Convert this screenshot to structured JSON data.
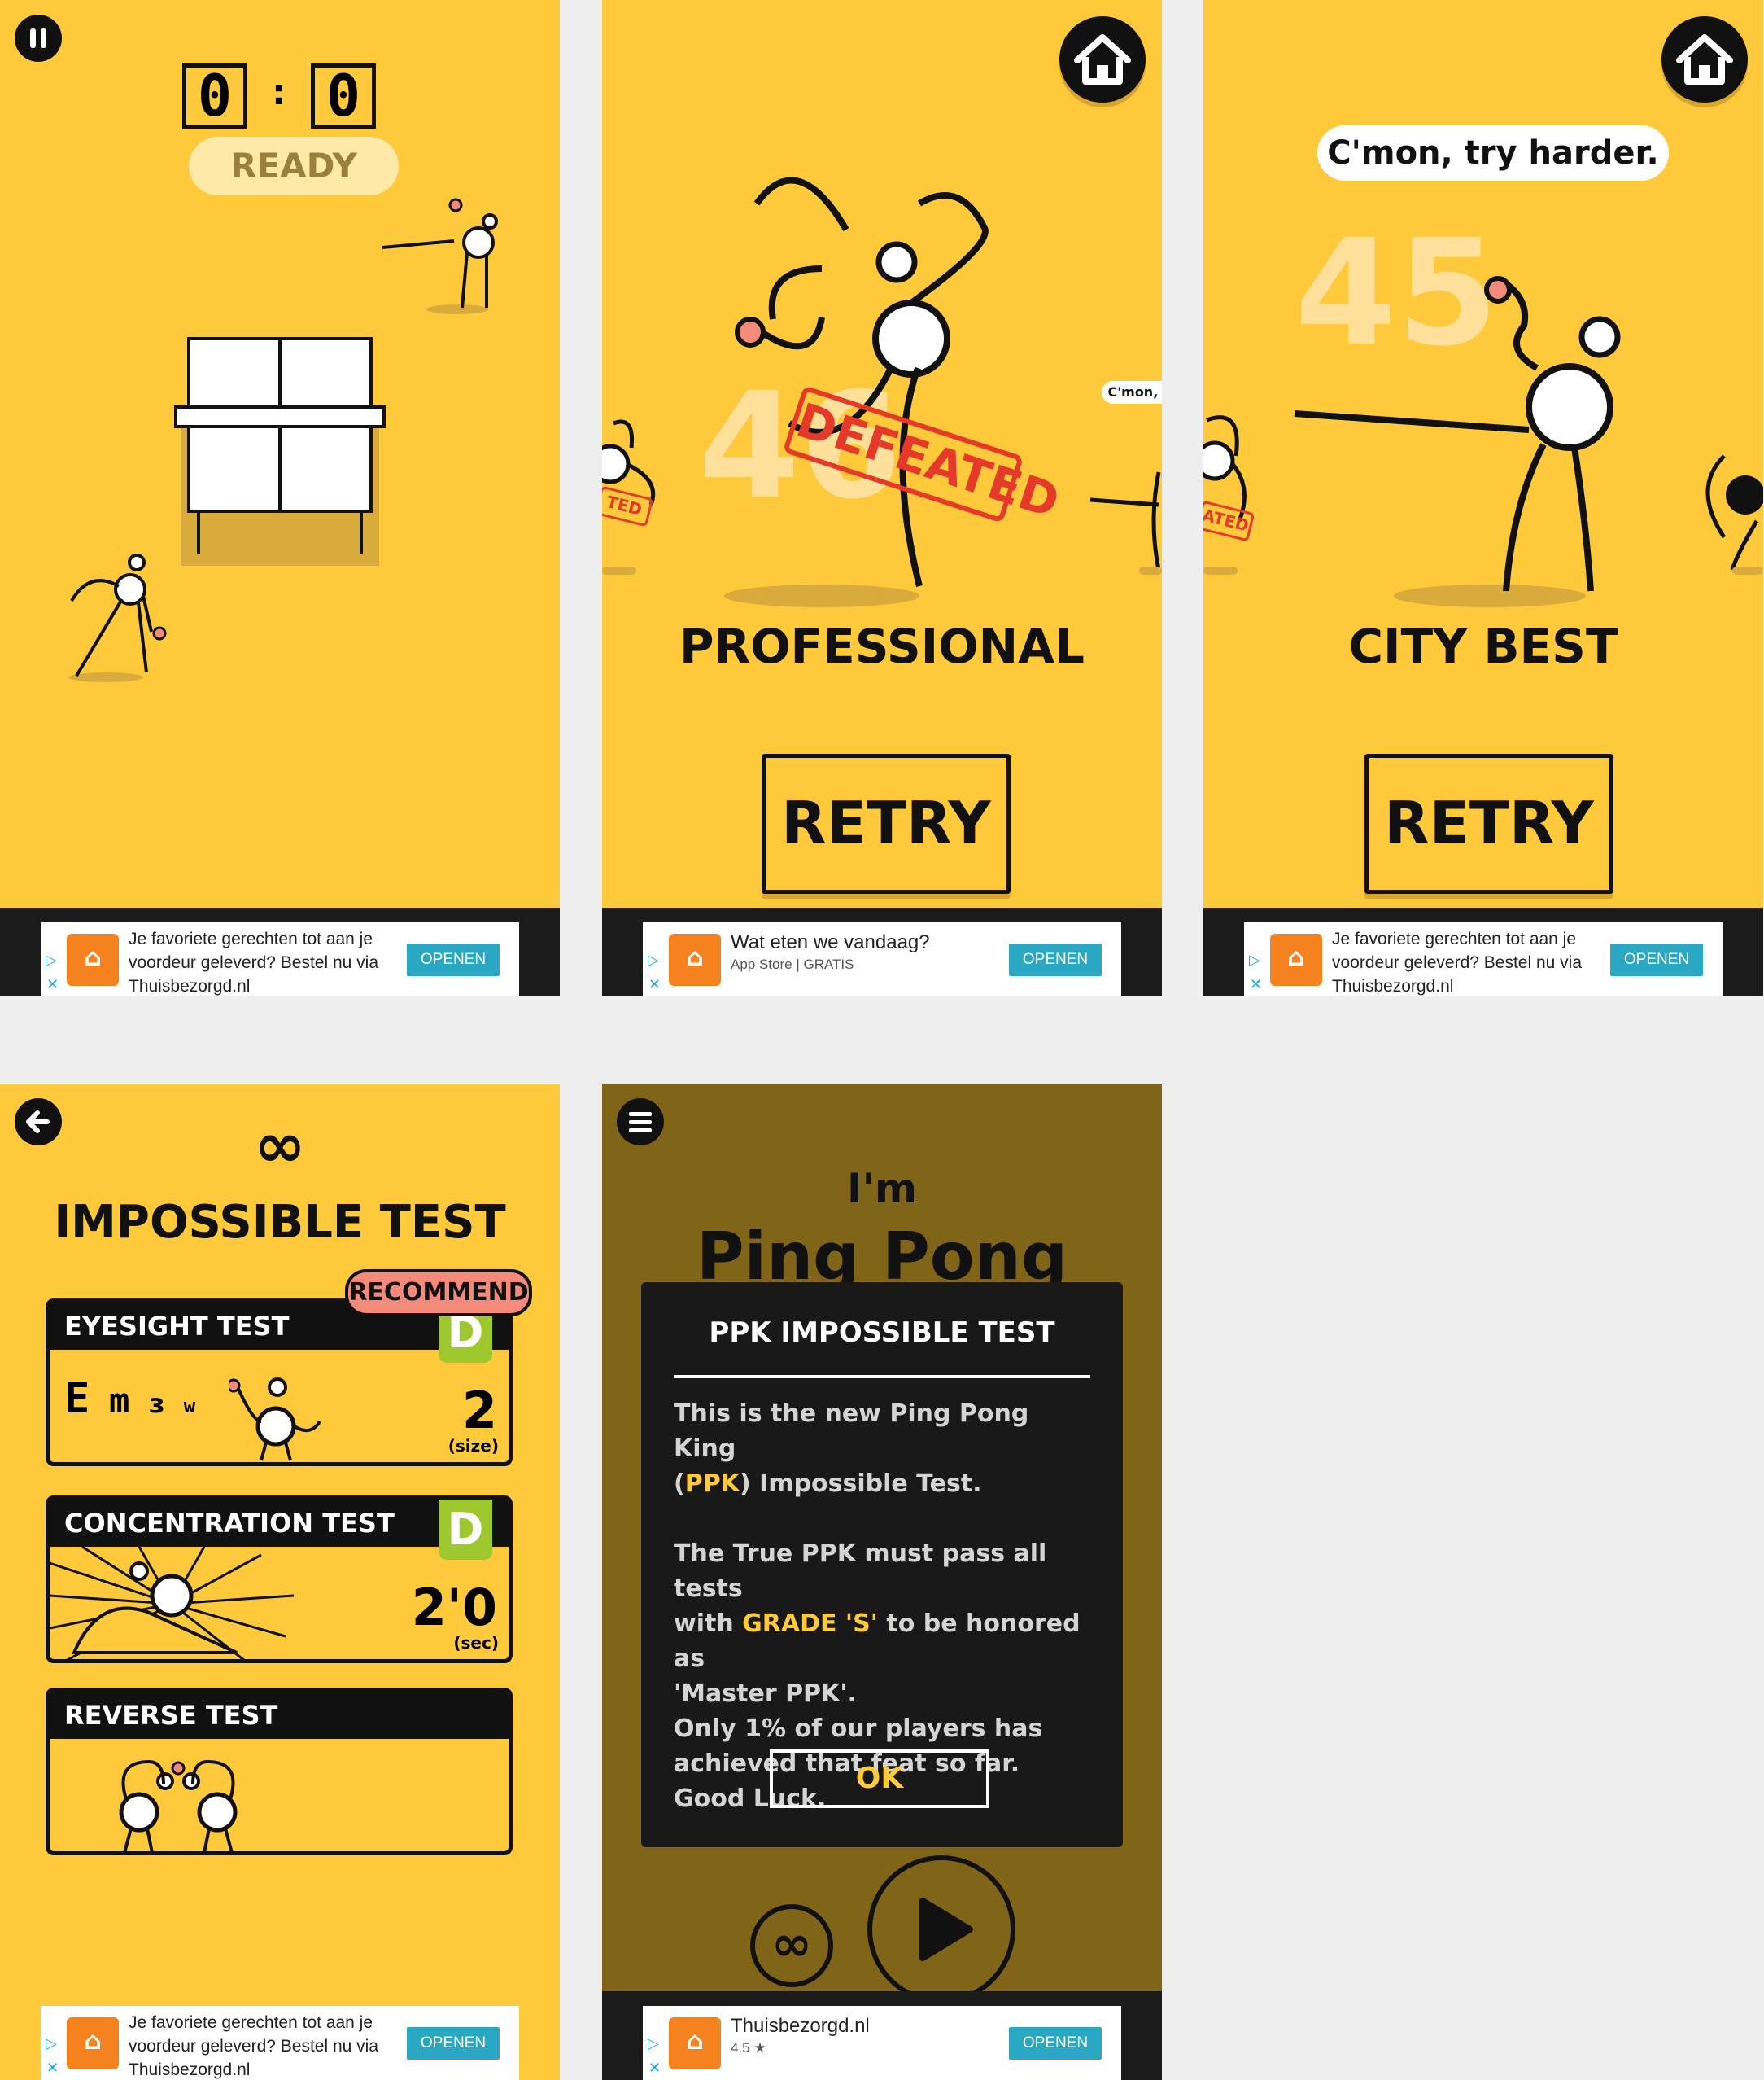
{
  "colors": {
    "yellow": "#fec93a",
    "dark": "#111111",
    "grade_green": "#9ec92e",
    "ad_button": "#2aa7c3",
    "recommend": "#f48a7a"
  },
  "screen1": {
    "pause_icon": "pause-icon",
    "score_left": "0",
    "score_sep": ":",
    "score_right": "0",
    "ready_label": "READY"
  },
  "screen2": {
    "home_icon": "home-icon",
    "big_score": "46",
    "stamp": "DEFEATED",
    "small_stamp": "TED",
    "peek_bubble": "C'mon, t",
    "rank": "PROFESSIONAL",
    "retry_label": "RETRY"
  },
  "screen3": {
    "home_icon": "home-icon",
    "bubble": "C'mon, try harder.",
    "big_score": "45",
    "small_stamp": "ATED",
    "rank": "CITY BEST",
    "retry_label": "RETRY"
  },
  "screen4": {
    "back_icon": "back-arrow-icon",
    "infinity": "∞",
    "title": "IMPOSSIBLE TEST",
    "recommend": "RECOMMEND",
    "tests": [
      {
        "name": "EYESIGHT TEST",
        "grade": "D",
        "value": "2",
        "unit": "(size)"
      },
      {
        "name": "CONCENTRATION TEST",
        "grade": "D",
        "value": "2'0",
        "unit": "(sec)"
      },
      {
        "name": "REVERSE TEST"
      }
    ],
    "eye_chart": [
      "E",
      "m",
      "ɜ",
      "w"
    ]
  },
  "screen5": {
    "menu_icon": "menu-icon",
    "im": "I'm",
    "ping_pong": "Ping Pong",
    "modal_title": "PPK IMPOSSIBLE TEST",
    "p1_a": "This is the new Ping Pong King",
    "p1_b_open": "(",
    "p1_b_ppk": "PPK",
    "p1_b_rest": ") Impossible Test.",
    "p2_a": "The True PPK must pass all tests",
    "p2_b_pre": "with ",
    "p2_b_grade": "GRADE 'S'",
    "p2_b_post": " to be honored as",
    "p2_c": "'Master PPK'.",
    "p2_d": "Only 1% of our players has",
    "p2_e": "achieved that feat so far.",
    "p2_f": "Good Luck.",
    "ok_label": "OK"
  },
  "ads": {
    "ad1": {
      "line1": "Je favoriete gerechten tot aan je",
      "line2": "voordeur geleverd? Bestel nu via",
      "line3": "Thuisbezorgd.nl",
      "button": "OPENEN"
    },
    "ad2": {
      "line1": "Wat eten we vandaag?",
      "line2": "App Store  |  GRATIS",
      "button": "OPENEN"
    },
    "ad3": {
      "line1": "Je favoriete gerechten tot aan je",
      "line2": "voordeur geleverd? Bestel nu via",
      "line3": "Thuisbezorgd.nl",
      "button": "OPENEN"
    },
    "ad4": {
      "line1": "Je favoriete gerechten tot aan je",
      "line2": "voordeur geleverd? Bestel nu via",
      "line3": "Thuisbezorgd.nl",
      "button": "OPENEN"
    },
    "ad5": {
      "line1": "Thuisbezorgd.nl",
      "line2": "4.5 ★",
      "button": "OPENEN"
    },
    "logo_glyph": "⌂",
    "play_glyph": "▷",
    "close_glyph": "✕"
  }
}
